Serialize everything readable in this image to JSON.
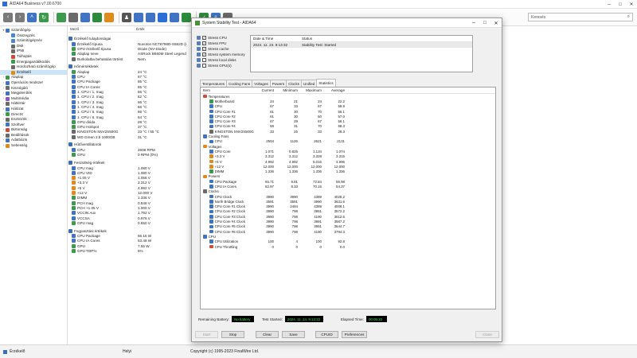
{
  "window": {
    "title": "AIDA64 Business v7.00.6700",
    "search_placeholder": "Keresés"
  },
  "tree": [
    {
      "label": "Számítógép",
      "level": 0,
      "tw": "▾",
      "color": "#3f73c4"
    },
    {
      "label": "Összegzés",
      "level": 1,
      "color": "#4a84d4"
    },
    {
      "label": "Számítógépnév",
      "level": 1,
      "color": "#4a84d4"
    },
    {
      "label": "DMI",
      "level": 1,
      "color": "#6a6a6a"
    },
    {
      "label": "IPMI",
      "level": 1,
      "color": "#6a6a6a"
    },
    {
      "label": "Túlhajtás",
      "level": 1,
      "color": "#d04b3a"
    },
    {
      "label": "Energiagazdálkodás",
      "level": 1,
      "color": "#3d9a4c"
    },
    {
      "label": "Hordozható számítógép",
      "level": 1,
      "color": "#6a6a6a"
    },
    {
      "label": "Érzékelő",
      "level": 1,
      "color": "#e08a1e",
      "selected": true
    },
    {
      "label": "Alaplap",
      "level": 0,
      "tw": "›",
      "color": "#3d9a4c"
    },
    {
      "label": "Operációs rendszer",
      "level": 0,
      "tw": "›",
      "color": "#3f73c4"
    },
    {
      "label": "Kiszolgáló",
      "level": 0,
      "tw": "›",
      "color": "#6a6a6a"
    },
    {
      "label": "Megjelenítés",
      "level": 0,
      "tw": "›",
      "color": "#3f73c4"
    },
    {
      "label": "Multimédia",
      "level": 0,
      "tw": "›",
      "color": "#8a56c4"
    },
    {
      "label": "Háttértár",
      "level": 0,
      "tw": "›",
      "color": "#6a6a6a"
    },
    {
      "label": "Hálózat",
      "level": 0,
      "tw": "›",
      "color": "#3f73c4"
    },
    {
      "label": "DirectX",
      "level": 0,
      "tw": "›",
      "color": "#3d9a4c"
    },
    {
      "label": "Eszközök",
      "level": 0,
      "tw": "›",
      "color": "#6a6a6a"
    },
    {
      "label": "Szoftver",
      "level": 0,
      "tw": "›",
      "color": "#3f73c4"
    },
    {
      "label": "Biztonság",
      "level": 0,
      "tw": "›",
      "color": "#d04b3a"
    },
    {
      "label": "Beállítások",
      "level": 0,
      "tw": "›",
      "color": "#6a6a6a"
    },
    {
      "label": "Adatbázis",
      "level": 0,
      "tw": "›",
      "color": "#3f73c4"
    },
    {
      "label": "Sebesség",
      "level": 0,
      "tw": "›",
      "color": "#e08a1e"
    }
  ],
  "columns": {
    "field": "Mező",
    "value": "Érték"
  },
  "props": [
    {
      "group": "Érzékelő tulajdonságai",
      "rows": [
        {
          "n": "Érzékelő típusa",
          "v": "Nuvoton NCT6796D-S582D (I",
          "c": "#3f73c4"
        },
        {
          "n": "GPU érzékelő típusa",
          "v": "Diode (NV-Diode)",
          "c": "#3d9a4c"
        },
        {
          "n": "Alaplap neve",
          "v": "ASRock B660M Steel Legend",
          "c": "#3d9a4c"
        },
        {
          "n": "Burkolatba behatolás történt",
          "v": "Nem",
          "c": "#6a6a6a"
        }
      ]
    },
    {
      "group": "Hőmérsékletek",
      "rows": [
        {
          "n": "Alaplap",
          "v": "24 °C",
          "c": "#3d9a4c"
        },
        {
          "n": "CPU",
          "v": "67 °C",
          "c": "#3f73c4"
        },
        {
          "n": "CPU Package",
          "v": "65 °C",
          "c": "#3f73c4"
        },
        {
          "n": "CPU IA Cores",
          "v": "65 °C",
          "c": "#3f73c4"
        },
        {
          "n": "1. CPU / 1. mag",
          "v": "66 °C",
          "c": "#3f73c4"
        },
        {
          "n": "1. CPU / 2. mag",
          "v": "62 °C",
          "c": "#3f73c4"
        },
        {
          "n": "1. CPU / 3. mag",
          "v": "66 °C",
          "c": "#3f73c4"
        },
        {
          "n": "1. CPU / 4. mag",
          "v": "66 °C",
          "c": "#3f73c4"
        },
        {
          "n": "1. CPU / 5. mag",
          "v": "66 °C",
          "c": "#3f73c4"
        },
        {
          "n": "1. CPU / 6. mag",
          "v": "64 °C",
          "c": "#3f73c4"
        },
        {
          "n": "GPU dióda",
          "v": "28 °C",
          "c": "#3d9a4c"
        },
        {
          "n": "GPU Hotspot",
          "v": "37 °C",
          "c": "#3d9a4c"
        },
        {
          "n": "KINGSTON SNV2S500G",
          "v": "33 °C / 55 °C",
          "c": "#6a6a6a"
        },
        {
          "n": "WD Green 2.5 1000GB",
          "v": "31 °C",
          "c": "#6a6a6a"
        }
      ]
    },
    {
      "group": "Hűtőventillátorok",
      "rows": [
        {
          "n": "CPU",
          "v": "2608 RPM",
          "c": "#3f73c4"
        },
        {
          "n": "GPU",
          "v": "0 RPM (0%)",
          "c": "#3d9a4c"
        }
      ]
    },
    {
      "group": "Feszültség értékek",
      "rows": [
        {
          "n": "CPU mag",
          "v": "1.080 V",
          "c": "#3f73c4"
        },
        {
          "n": "CPU VID",
          "v": "1.080 V",
          "c": "#3f73c4"
        },
        {
          "n": "+1.05 V",
          "v": "1.056 V",
          "c": "#e08a1e"
        },
        {
          "n": "+3.3 V",
          "v": "3.312 V",
          "c": "#e08a1e"
        },
        {
          "n": "+5 V",
          "v": "4.992 V",
          "c": "#e08a1e"
        },
        {
          "n": "+12 V",
          "v": "12.000 V",
          "c": "#e08a1e"
        },
        {
          "n": "DIMM",
          "v": "1.336 V",
          "c": "#3d9a4c"
        },
        {
          "n": "PCH mag",
          "v": "0.848 V",
          "c": "#3d9a4c"
        },
        {
          "n": "PCH +1.05 V",
          "v": "1.000 V",
          "c": "#3d9a4c"
        },
        {
          "n": "VCCIN Aux",
          "v": "1.792 V",
          "c": "#3f73c4"
        },
        {
          "n": "VCCSA",
          "v": "0.976 V",
          "c": "#3f73c4"
        },
        {
          "n": "GPU mag",
          "v": "0.650 V",
          "c": "#3d9a4c"
        }
      ]
    },
    {
      "group": "Fogyasztási értékek",
      "rows": [
        {
          "n": "CPU Package",
          "v": "66.15 W",
          "c": "#3f73c4"
        },
        {
          "n": "CPU IA Cores",
          "v": "63.48 W",
          "c": "#3f73c4"
        },
        {
          "n": "GPU",
          "v": "7.55 W",
          "c": "#3d9a4c"
        },
        {
          "n": "GPU TDP%",
          "v": "5%",
          "c": "#3d9a4c"
        }
      ]
    }
  ],
  "statusbar": {
    "left": "Érzékelő",
    "middle": "Helyi",
    "copyright": "Copyright (c) 1995-2023 FinalWire Ltd."
  },
  "dialog": {
    "title": "System Stability Test - AIDA64",
    "stress": [
      {
        "label": "Stress CPU",
        "checked": true
      },
      {
        "label": "Stress FPU",
        "checked": true
      },
      {
        "label": "Stress cache",
        "checked": true
      },
      {
        "label": "Stress system memory",
        "checked": true
      },
      {
        "label": "Stress local disks",
        "checked": false
      },
      {
        "label": "Stress GPU(s)",
        "checked": false
      }
    ],
    "events": {
      "col1": "Date & Time",
      "col2": "Status",
      "row_date": "2024. 11. 24. 9:13:32",
      "row_status": "Stability Test: Started"
    },
    "tabs": [
      "Temperatures",
      "Cooling Fans",
      "Voltages",
      "Powers",
      "Clocks",
      "Unified",
      "Statistics"
    ],
    "active_tab": 6,
    "grid_header": {
      "item": "Item",
      "current": "Current",
      "min": "Minimum",
      "max": "Maximum",
      "avg": "Average"
    },
    "grid_rows": [
      {
        "t": "cat",
        "item": "Temperatures",
        "c": "#d04b3a"
      },
      {
        "t": "sub",
        "item": "Motherboard",
        "cur": "24",
        "min": "21",
        "max": "24",
        "avg": "22.2",
        "c": "#3d9a4c"
      },
      {
        "t": "sub",
        "item": "CPU",
        "cur": "67",
        "min": "33",
        "max": "67",
        "avg": "58.9",
        "c": "#3f73c4"
      },
      {
        "t": "sub",
        "item": "CPU Core #1",
        "cur": "61",
        "min": "30",
        "max": "70",
        "avg": "56.1",
        "c": "#3f73c4"
      },
      {
        "t": "sub",
        "item": "CPU Core #2",
        "cur": "61",
        "min": "30",
        "max": "60",
        "avg": "57.0",
        "c": "#3f73c4"
      },
      {
        "t": "sub",
        "item": "CPU Core #3",
        "cur": "67",
        "min": "29",
        "max": "67",
        "avg": "56.1",
        "c": "#3f73c4"
      },
      {
        "t": "sub",
        "item": "CPU Core #4",
        "cur": "68",
        "min": "31",
        "max": "70",
        "avg": "58.3",
        "c": "#3f73c4"
      },
      {
        "t": "sub",
        "item": "KINGSTON SNV2S500G",
        "cur": "33",
        "min": "25",
        "max": "33",
        "avg": "28.3",
        "c": "#6a6a6a"
      },
      {
        "t": "cat",
        "item": "Cooling Fans",
        "c": "#3f73c4"
      },
      {
        "t": "sub",
        "item": "CPU",
        "cur": "2504",
        "min": "1126",
        "max": "2621",
        "avg": "2131",
        "c": "#3f73c4"
      },
      {
        "t": "cat",
        "item": "Voltages",
        "c": "#e08a1e"
      },
      {
        "t": "sub",
        "item": "CPU Core",
        "cur": "1.071",
        "min": "0.825",
        "max": "1.134",
        "avg": "1.074",
        "c": "#3f73c4"
      },
      {
        "t": "sub",
        "item": "+3.3 V",
        "cur": "3.312",
        "min": "3.312",
        "max": "3.328",
        "avg": "3.315",
        "c": "#e08a1e"
      },
      {
        "t": "sub",
        "item": "+5 V",
        "cur": "4.992",
        "min": "4.992",
        "max": "5.016",
        "avg": "4.996",
        "c": "#e08a1e"
      },
      {
        "t": "sub",
        "item": "+12 V",
        "cur": "12.000",
        "min": "12.000",
        "max": "12.000",
        "avg": "12.000",
        "c": "#e08a1e"
      },
      {
        "t": "sub",
        "item": "DIMM",
        "cur": "1.336",
        "min": "1.336",
        "max": "1.336",
        "avg": "1.336",
        "c": "#3d9a4c"
      },
      {
        "t": "cat",
        "item": "Powers",
        "c": "#e08a1e"
      },
      {
        "t": "sub",
        "item": "CPU Package",
        "cur": "65.71",
        "min": "9.81",
        "max": "72.84",
        "avg": "56.98",
        "c": "#3f73c4"
      },
      {
        "t": "sub",
        "item": "CPU IA Cores",
        "cur": "62.97",
        "min": "8.33",
        "max": "70.15",
        "avg": "54.37",
        "c": "#3f73c4"
      },
      {
        "t": "cat",
        "item": "Clocks",
        "c": "#6a6a6a"
      },
      {
        "t": "sub",
        "item": "CPU Clock",
        "cur": "3990",
        "min": "3990",
        "max": "4389",
        "avg": "4028.2",
        "c": "#3f73c4"
      },
      {
        "t": "sub",
        "item": "North Bridge Clock",
        "cur": "3591",
        "min": "3591",
        "max": "3990",
        "avg": "3631.6",
        "c": "#3f73c4"
      },
      {
        "t": "sub",
        "item": "CPU Core #1 Clock",
        "cur": "3990",
        "min": "2494",
        "max": "4389",
        "avg": "4008.1",
        "c": "#3f73c4"
      },
      {
        "t": "sub",
        "item": "CPU Core #2 Clock",
        "cur": "3990",
        "min": "798",
        "max": "3991",
        "avg": "3572.2",
        "c": "#3f73c4"
      },
      {
        "t": "sub",
        "item": "CPU Core #3 Clock",
        "cur": "3990",
        "min": "798",
        "max": "4190",
        "avg": "3612.6",
        "c": "#3f73c4"
      },
      {
        "t": "sub",
        "item": "CPU Core #4 Clock",
        "cur": "3990",
        "min": "798",
        "max": "3991",
        "avg": "3587.2",
        "c": "#3f73c4"
      },
      {
        "t": "sub",
        "item": "CPU Core #5 Clock",
        "cur": "3990",
        "min": "798",
        "max": "3991",
        "avg": "3644.7",
        "c": "#3f73c4"
      },
      {
        "t": "sub",
        "item": "CPU Core #6 Clock",
        "cur": "3990",
        "min": "798",
        "max": "4190",
        "avg": "3794.3",
        "c": "#3f73c4"
      },
      {
        "t": "cat",
        "item": "CPU",
        "c": "#3f73c4"
      },
      {
        "t": "sub",
        "item": "CPU Utilization",
        "cur": "100",
        "min": "4",
        "max": "100",
        "avg": "92.8",
        "c": "#3f73c4"
      },
      {
        "t": "sub",
        "item": "CPU Throttling",
        "cur": "0",
        "min": "0",
        "max": "0",
        "avg": "0.0",
        "c": "#d04b3a"
      }
    ],
    "status": {
      "battery_label": "Remaining Battery:",
      "battery_value": "No battery",
      "started_label": "Test Started:",
      "started_value": "2024. 11. 24. 9:13:32",
      "elapsed_label": "Elapsed Time:",
      "elapsed_value": "00:05:20"
    },
    "buttons": {
      "start": "Start",
      "stop": "Stop",
      "clear": "Clear",
      "save": "Save",
      "cpuid": "CPUID",
      "preferences": "Preferences",
      "close": "Close"
    }
  }
}
